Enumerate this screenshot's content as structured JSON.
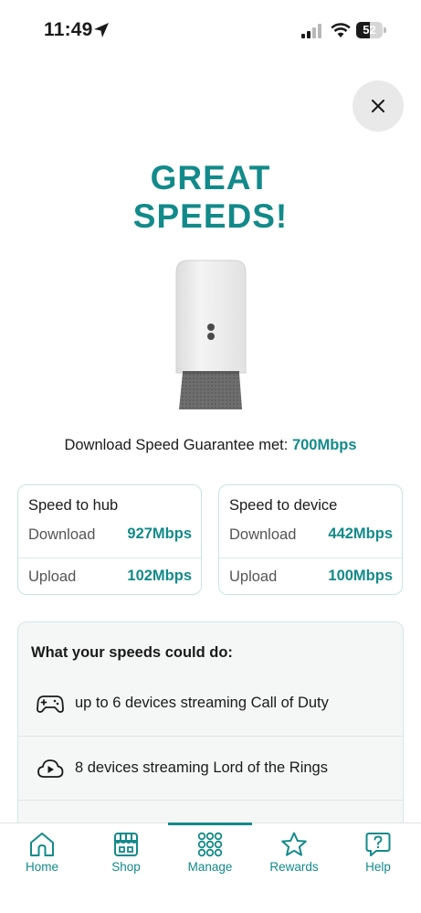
{
  "status_bar": {
    "time": "11:49",
    "battery_level": "52",
    "battery_fill": 0.52,
    "icons": [
      "location-arrow-icon",
      "cellular-signal-icon",
      "wifi-icon",
      "battery-icon"
    ]
  },
  "colors": {
    "accent": "#138a8a",
    "card_border": "#c9e3e3",
    "panel_bg": "#f5f7f7"
  },
  "close": {
    "icon": "close-icon"
  },
  "hero": {
    "title_line1": "GREAT",
    "title_line2": "SPEEDS!"
  },
  "guarantee": {
    "text": "Download Speed Guarantee met: ",
    "value": "700Mbps"
  },
  "speed_to_hub": {
    "title": "Speed to hub",
    "download_label": "Download",
    "download_value": "927Mbps",
    "upload_label": "Upload",
    "upload_value": "102Mbps"
  },
  "speed_to_device": {
    "title": "Speed to device",
    "download_label": "Download",
    "download_value": "442Mbps",
    "upload_label": "Upload",
    "upload_value": "100Mbps"
  },
  "could_do": {
    "title": "What your speeds could do:",
    "items": [
      {
        "icon": "gamepad-icon",
        "text": "up to 6 devices streaming Call of Duty"
      },
      {
        "icon": "play-cloud-icon",
        "text": "8 devices streaming Lord of the Rings"
      }
    ]
  },
  "bottom_nav": {
    "items": [
      {
        "icon": "home-icon",
        "label": "Home"
      },
      {
        "icon": "shop-icon",
        "label": "Shop"
      },
      {
        "icon": "grid-icon",
        "label": "Manage"
      },
      {
        "icon": "star-icon",
        "label": "Rewards"
      },
      {
        "icon": "help-icon",
        "label": "Help"
      }
    ],
    "active": "Manage"
  }
}
